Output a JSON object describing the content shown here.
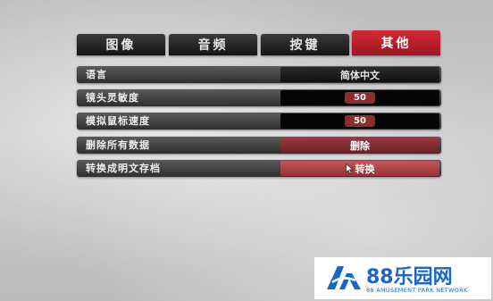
{
  "tabs": [
    {
      "label": "图像",
      "active": false
    },
    {
      "label": "音频",
      "active": false
    },
    {
      "label": "按键",
      "active": false
    },
    {
      "label": "其他",
      "active": true
    }
  ],
  "settings": [
    {
      "label": "语言",
      "control": "select",
      "value": "简体中文"
    },
    {
      "label": "镜头灵敏度",
      "control": "slider",
      "value": "50"
    },
    {
      "label": "模拟鼠标速度",
      "control": "slider",
      "value": "50"
    },
    {
      "label": "删除所有数据",
      "control": "button",
      "value": "删除"
    },
    {
      "label": "转换成明文存档",
      "control": "button",
      "value": "转换"
    }
  ],
  "watermark": {
    "brand": "88乐园网",
    "subtitle": "88 AMUSEMENT PARK NETWORK"
  },
  "colors": {
    "active_tab": "#c4202b",
    "button": "#7d2a30",
    "button_hover": "#b4464d",
    "slider_value": "#8a2f2f",
    "logo_blue": "#1b64c8"
  },
  "icons": {
    "cursor": "arrow-cursor-icon",
    "logo_mark": "wave-triangle-logo-icon"
  }
}
